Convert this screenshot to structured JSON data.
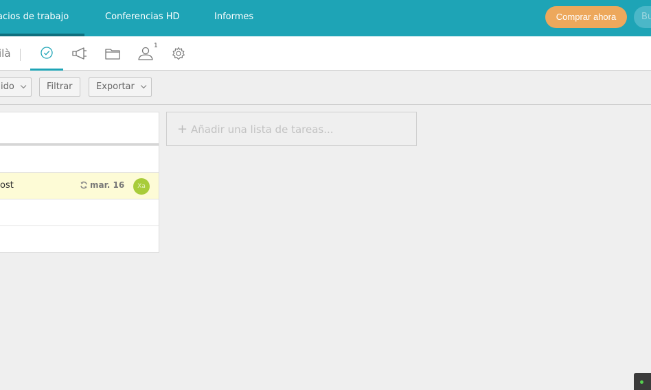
{
  "topnav": {
    "items": [
      {
        "label": "acios de trabajo"
      },
      {
        "label": "Conferencias HD"
      },
      {
        "label": "Informes"
      }
    ],
    "buy_label": "Comprar ahora",
    "search_label": "Bu"
  },
  "subbar": {
    "project_name": "ilà",
    "tabs": [
      {
        "icon": "check-circle-icon",
        "active": true
      },
      {
        "icon": "megaphone-icon"
      },
      {
        "icon": "folder-icon"
      },
      {
        "icon": "user-icon",
        "badge": "1"
      },
      {
        "icon": "gear-icon"
      }
    ]
  },
  "toolbar": {
    "sort_label": "ido",
    "filter_label": "Filtrar",
    "export_label": "Exportar"
  },
  "tasklist": {
    "tasks": [
      {
        "name": "",
        "date": "",
        "avatar": ""
      },
      {
        "name": "ost",
        "date": "mar. 16",
        "avatar": "Xa",
        "recurring": true,
        "highlighted": true
      },
      {
        "name": "",
        "date": "",
        "avatar": ""
      },
      {
        "name": "",
        "date": "",
        "avatar": ""
      }
    ]
  },
  "addlist": {
    "label": "Añadir una lista de tareas..."
  },
  "colors": {
    "brand": "#1ea4b6",
    "accent": "#eda85c",
    "avatar": "#a8cc3a",
    "highlight": "#fdfbd6"
  }
}
